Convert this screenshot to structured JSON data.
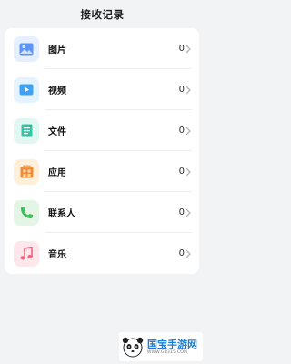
{
  "header": {
    "title": "接收记录"
  },
  "items": [
    {
      "label": "图片",
      "count": "0",
      "icon": "image-icon",
      "color": "#4f8ef7"
    },
    {
      "label": "视频",
      "count": "0",
      "icon": "video-icon",
      "color": "#3aa0f3"
    },
    {
      "label": "文件",
      "count": "0",
      "icon": "file-icon",
      "color": "#2fc3a0"
    },
    {
      "label": "应用",
      "count": "0",
      "icon": "app-icon",
      "color": "#f08a2c"
    },
    {
      "label": "联系人",
      "count": "0",
      "icon": "contact-phone-icon",
      "color": "#3fbf5b"
    },
    {
      "label": "音乐",
      "count": "0",
      "icon": "music-icon",
      "color": "#f0647e"
    }
  ],
  "watermark": {
    "title": "国宝手游网",
    "url": "WWW.GB315.COM"
  }
}
